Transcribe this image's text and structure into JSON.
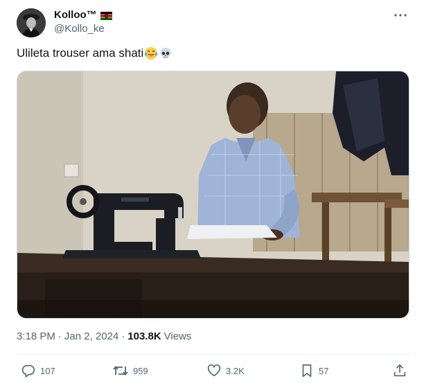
{
  "user": {
    "display_name": "Kolloo™",
    "handle": "@Kollo_ke",
    "flag_icon": "kenya-flag-icon"
  },
  "tweet": {
    "text": "Ulileta trouser ama shati",
    "emojis": [
      "face-with-tears-of-joy",
      "skull"
    ]
  },
  "meta": {
    "time": "3:18 PM",
    "separator": "·",
    "date": "Jan 2, 2024",
    "views_count": "103.8K",
    "views_label": "Views"
  },
  "actions": {
    "replies": "107",
    "reposts": "959",
    "likes": "3.2K",
    "bookmarks": "57"
  },
  "colors": {
    "text_primary": "#0f1419",
    "text_secondary": "#536471",
    "border": "#cfd9de"
  }
}
